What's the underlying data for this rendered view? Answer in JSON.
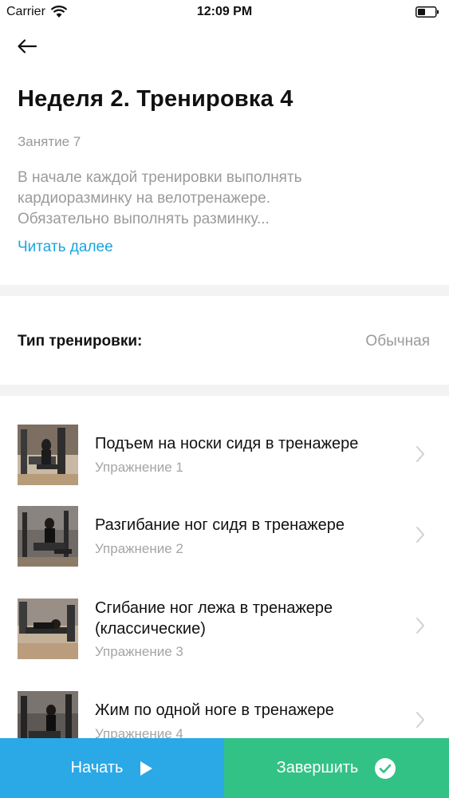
{
  "status_bar": {
    "carrier": "Carrier",
    "time": "12:09 PM"
  },
  "header": {
    "title": "Неделя 2. Тренировка 4",
    "subtitle": "Занятие 7",
    "description_lines": [
      "В начале каждой тренировки выполнять",
      "кардиоразминку на велотренажере.",
      "Обязательно выполнять разминку..."
    ],
    "read_more": "Читать далее"
  },
  "workout_type": {
    "label": "Тип тренировки:",
    "value": "Обычная"
  },
  "exercises": [
    {
      "title_lines": [
        "Подъем на носки сидя в тренажере"
      ],
      "subtitle": "Упражнение 1"
    },
    {
      "title_lines": [
        "Разгибание ног сидя в тренажере"
      ],
      "subtitle": "Упражнение 2"
    },
    {
      "title_lines": [
        "Сгибание ног лежа в тренажере",
        "(классические)"
      ],
      "subtitle": "Упражнение 3"
    },
    {
      "title_lines": [
        "Жим по одной ноге в тренажере"
      ],
      "subtitle": "Упражнение 4"
    }
  ],
  "bottom_bar": {
    "start_label": "Начать",
    "finish_label": "Завершить"
  },
  "colors": {
    "accent_link": "#1aa6de",
    "start_button": "#2ba8e6",
    "finish_button": "#33c285"
  },
  "icons": [
    "wifi-icon",
    "battery-icon",
    "back-arrow-icon",
    "chevron-right-icon",
    "play-icon",
    "check-circle-icon"
  ]
}
